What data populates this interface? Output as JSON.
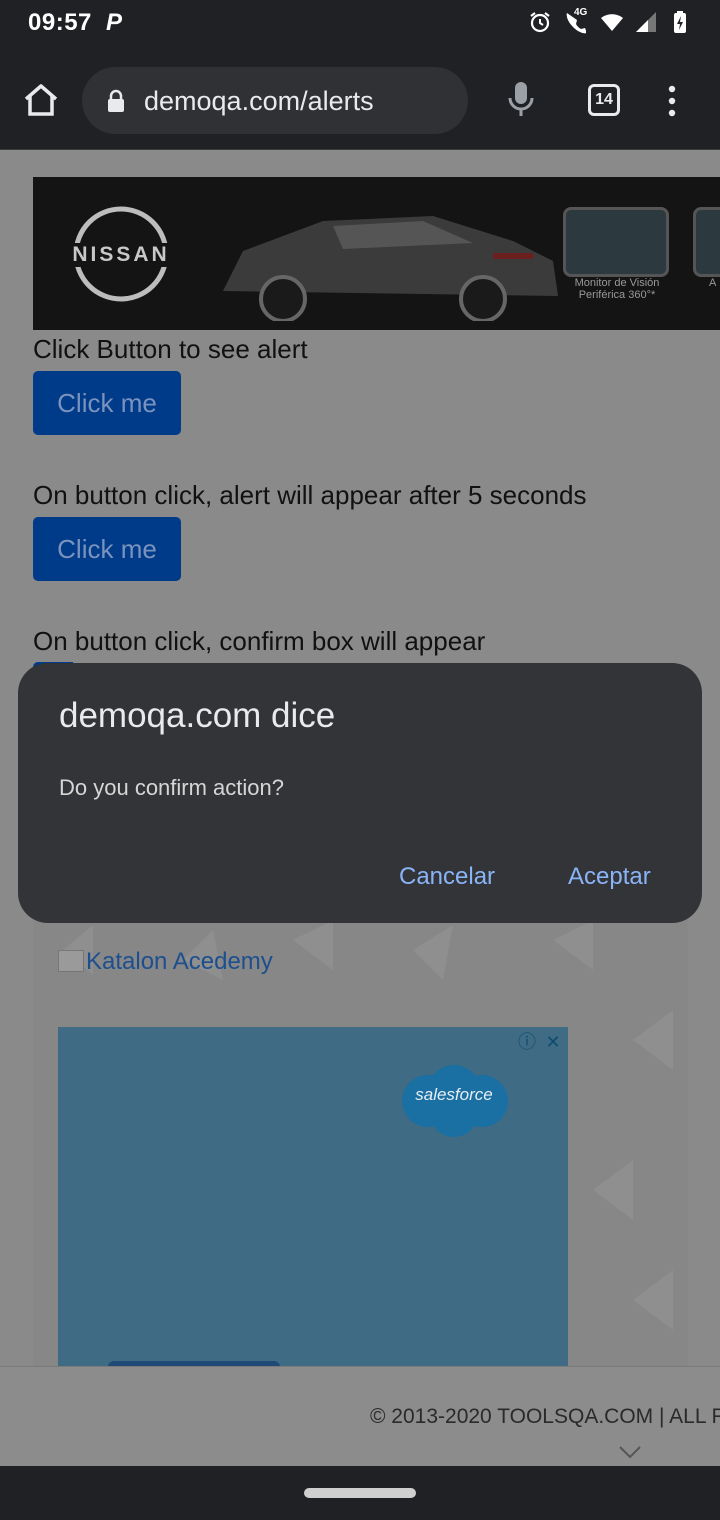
{
  "status_bar": {
    "time": "09:57",
    "notification_icon": "P",
    "network_label": "4G",
    "icons": [
      "alarm-icon",
      "wifi-call-icon",
      "wifi-icon",
      "signal-icon",
      "battery-charging-icon"
    ]
  },
  "browser": {
    "url": "demoqa.com/alerts",
    "tab_count": "14"
  },
  "page": {
    "ad_banner": {
      "brand": "NISSAN",
      "caption": "Monitor de Visión Periférica 360°*",
      "caption2": "A"
    },
    "sections": [
      {
        "label": "Click Button to see alert",
        "button": "Click me"
      },
      {
        "label": "On button click, alert will appear after 5 seconds",
        "button": "Click me"
      },
      {
        "label": "On button click, confirm box will appear"
      }
    ],
    "katalon_link": "Katalon Acedemy",
    "ad_brand": "salesforce",
    "footer": "© 2013-2020 TOOLSQA.COM | ALL R"
  },
  "dialog": {
    "title": "demoqa.com dice",
    "message": "Do you confirm action?",
    "cancel_label": "Cancelar",
    "accept_label": "Aceptar"
  },
  "colors": {
    "dialog_bg": "#333437",
    "dialog_button": "#8ab4f8",
    "primary_button": "#003b8a",
    "chrome_bg": "#202124"
  }
}
